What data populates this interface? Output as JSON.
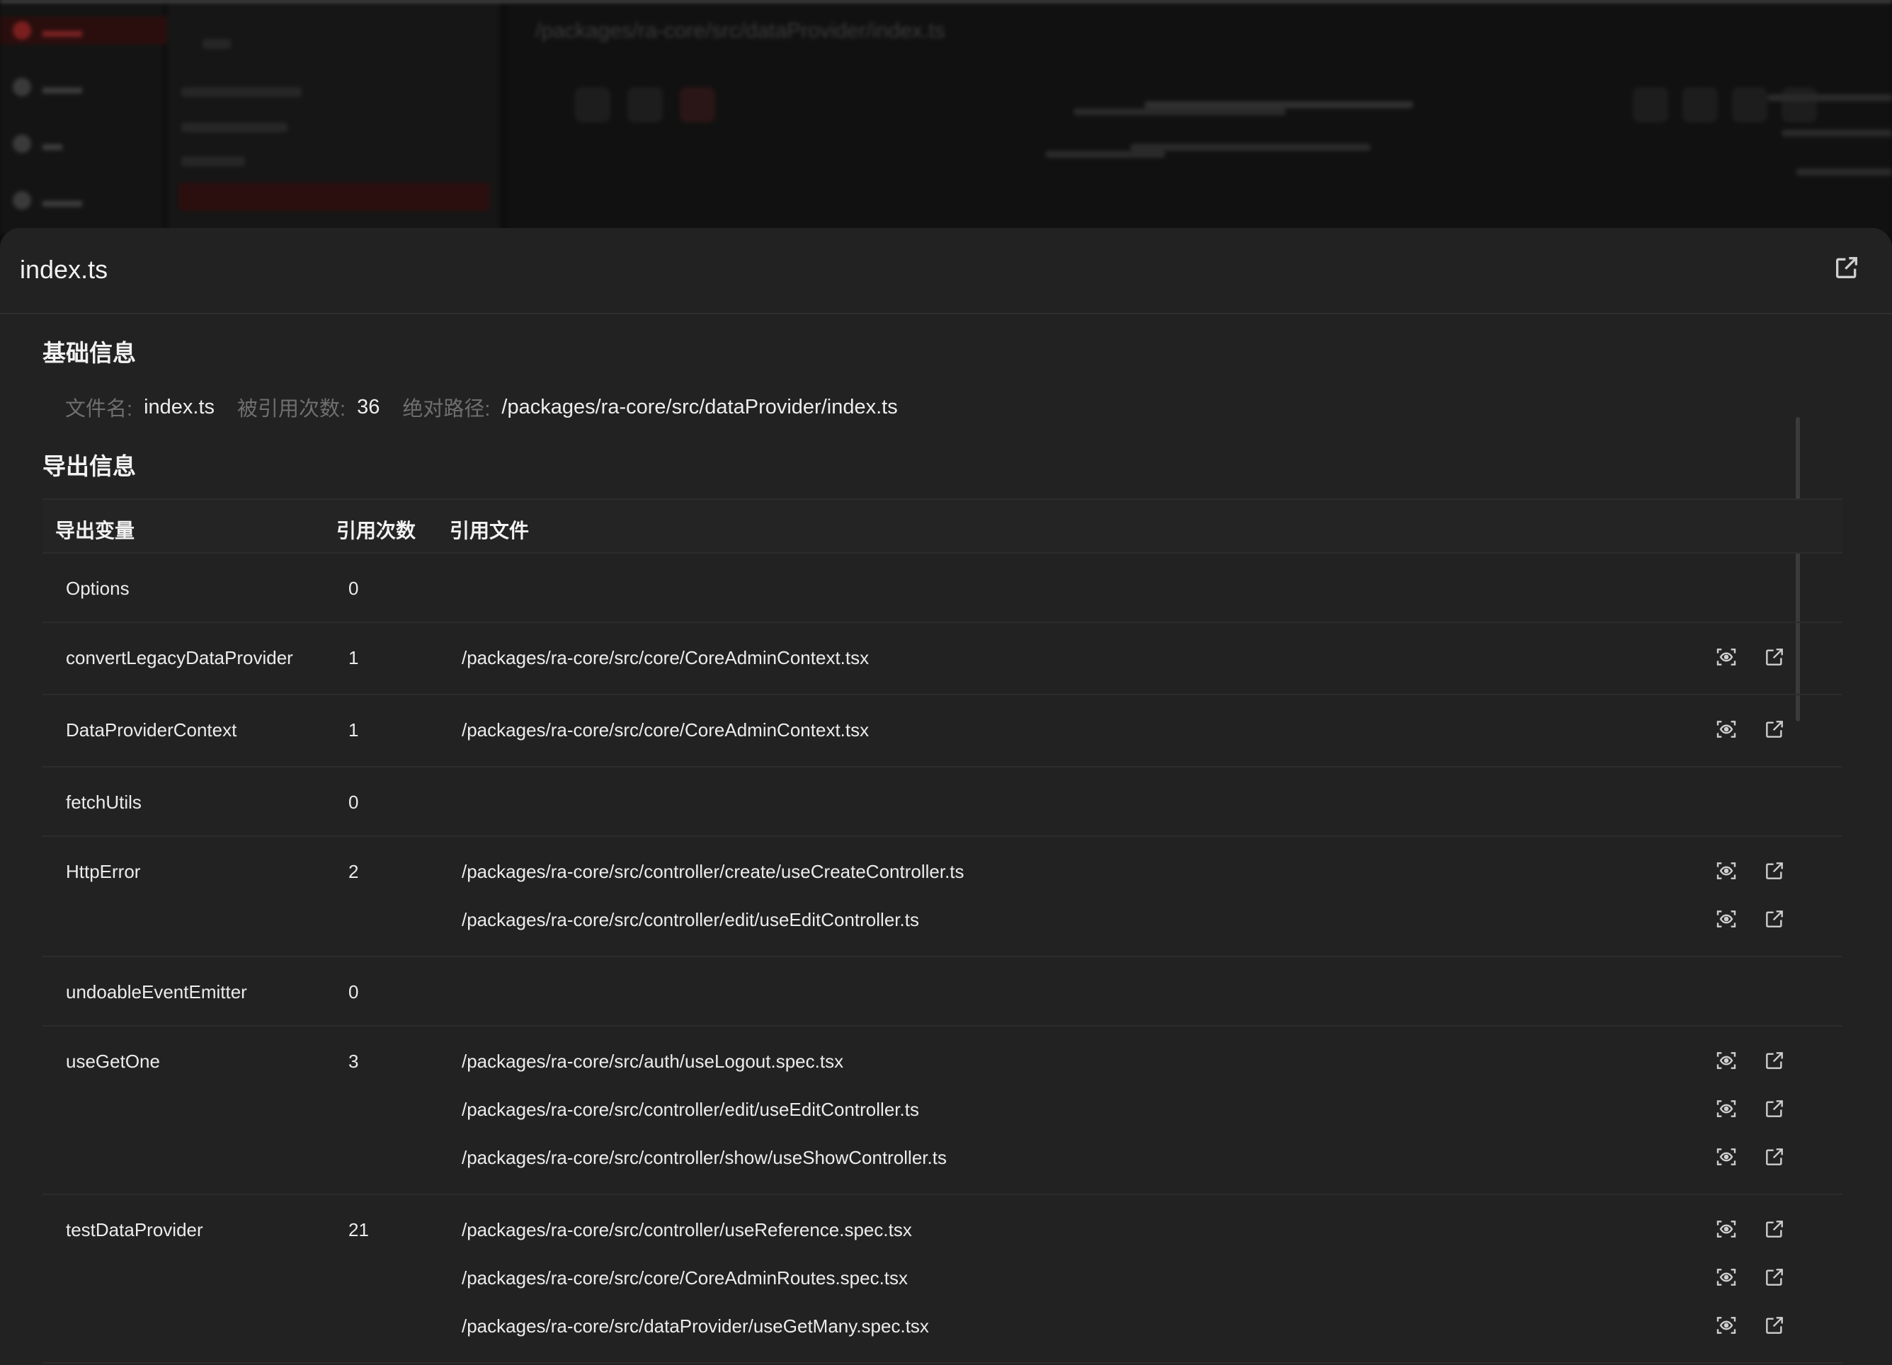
{
  "background": {
    "path": "/packages/ra-core/src/dataProvider/index.ts"
  },
  "panel": {
    "title": "index.ts",
    "basic_info": {
      "heading": "基础信息",
      "file_name_label": "文件名:",
      "file_name": "index.ts",
      "ref_count_label": "被引用次数:",
      "ref_count": "36",
      "abs_path_label": "绝对路径:",
      "abs_path": "/packages/ra-core/src/dataProvider/index.ts"
    },
    "export_info": {
      "heading": "导出信息",
      "columns": [
        "导出变量",
        "引用次数",
        "引用文件"
      ],
      "rows": [
        {
          "name": "Options",
          "count": "0",
          "files": []
        },
        {
          "name": "convertLegacyDataProvider",
          "count": "1",
          "files": [
            "/packages/ra-core/src/core/CoreAdminContext.tsx"
          ]
        },
        {
          "name": "DataProviderContext",
          "count": "1",
          "files": [
            "/packages/ra-core/src/core/CoreAdminContext.tsx"
          ]
        },
        {
          "name": "fetchUtils",
          "count": "0",
          "files": []
        },
        {
          "name": "HttpError",
          "count": "2",
          "files": [
            "/packages/ra-core/src/controller/create/useCreateController.ts",
            "/packages/ra-core/src/controller/edit/useEditController.ts"
          ]
        },
        {
          "name": "undoableEventEmitter",
          "count": "0",
          "files": []
        },
        {
          "name": "useGetOne",
          "count": "3",
          "files": [
            "/packages/ra-core/src/auth/useLogout.spec.tsx",
            "/packages/ra-core/src/controller/edit/useEditController.ts",
            "/packages/ra-core/src/controller/show/useShowController.ts"
          ]
        },
        {
          "name": "testDataProvider",
          "count": "21",
          "files": [
            "/packages/ra-core/src/controller/useReference.spec.tsx",
            "/packages/ra-core/src/core/CoreAdminRoutes.spec.tsx",
            "/packages/ra-core/src/dataProvider/useGetMany.spec.tsx"
          ]
        }
      ]
    }
  },
  "icons": {
    "preview": "eye-scan-icon",
    "open": "external-link-icon"
  },
  "colors": {
    "panel_bg": "#222222",
    "page_bg": "#0e0e0e",
    "accent": "#7a1e1e",
    "muted_label": "#6f6f6f"
  }
}
